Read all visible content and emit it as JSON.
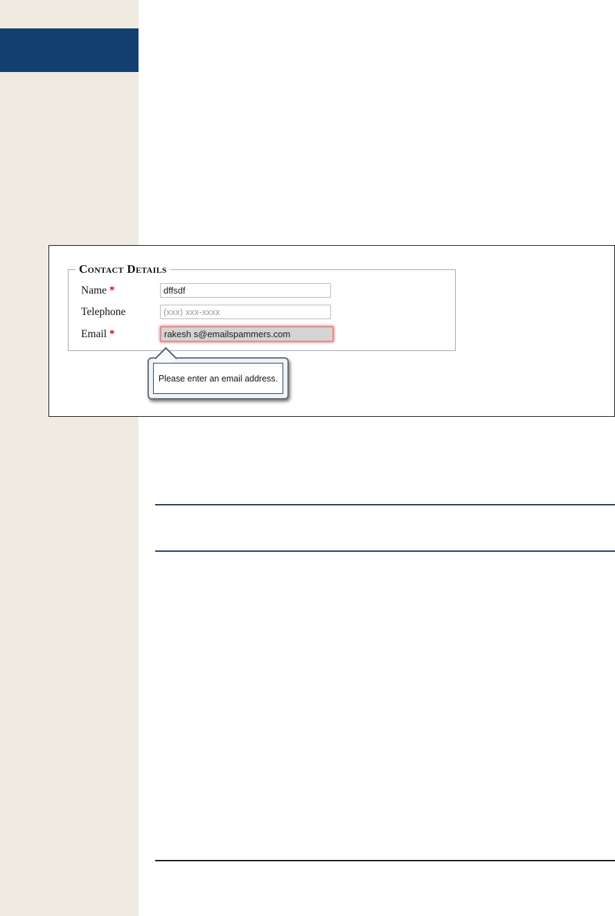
{
  "sidebar": {
    "color": "#efebe0",
    "accent_block_color": "#133f6f"
  },
  "form": {
    "legend": "Contact Details",
    "required_marker": "*",
    "fields": [
      {
        "label": "Name",
        "required": true,
        "value": "dffsdf",
        "placeholder": ""
      },
      {
        "label": "Telephone",
        "required": false,
        "value": "",
        "placeholder": "(xxx) xxx-xxxx"
      },
      {
        "label": "Email",
        "required": true,
        "value": "rakesh s@emailspammers.com",
        "placeholder": "",
        "invalid": true
      }
    ],
    "validation_tooltip": "Please enter an email address."
  },
  "rules": {
    "blue_color": "#16406d",
    "dark_color": "#1b1b1b"
  },
  "colors": {
    "invalid_border": "#e58c8c",
    "invalid_background": "#d4d4d4",
    "asterisk": "#e00000"
  }
}
